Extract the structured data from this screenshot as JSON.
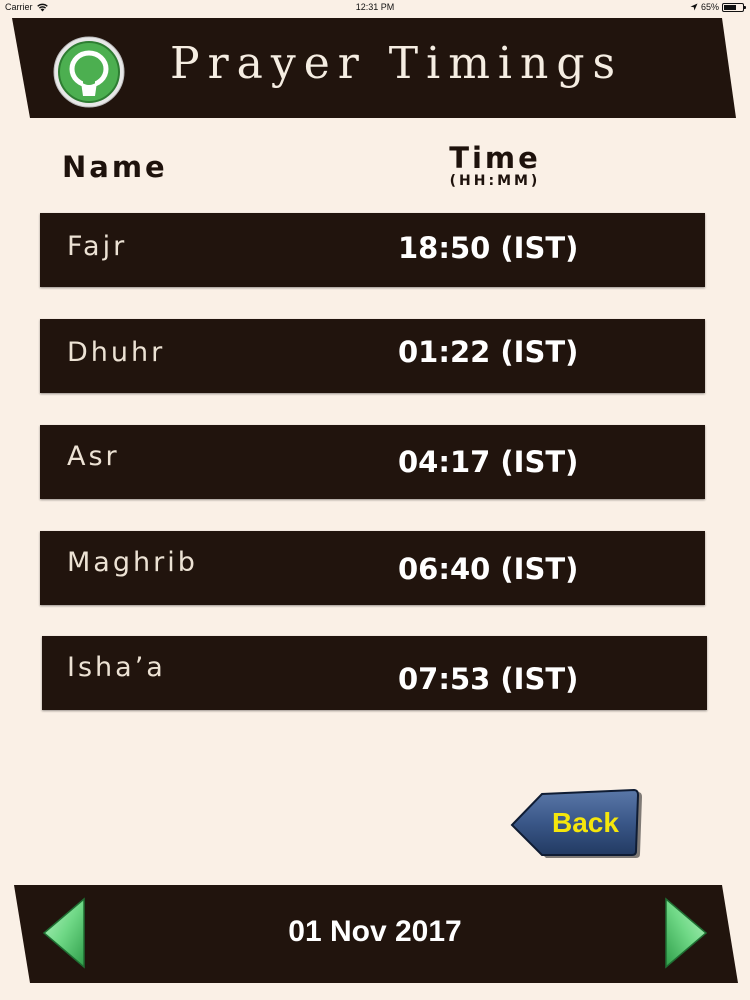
{
  "status_bar": {
    "carrier": "Carrier",
    "time": "12:31 PM",
    "battery": "65%",
    "battery_level": 0.65,
    "icons": [
      "wifi-icon",
      "location-arrow-icon",
      "battery-icon"
    ]
  },
  "header": {
    "title": "Prayer Timings",
    "logo_icon": "app-logo-icon"
  },
  "columns": {
    "name_label": "Name",
    "time_label": "Time",
    "time_unit": "(HH:MM)"
  },
  "prayers": [
    {
      "name": "Fajr",
      "time": "18:50 (IST)"
    },
    {
      "name": "Dhuhr",
      "time": "01:22 (IST)"
    },
    {
      "name": "Asr",
      "time": "04:17 (IST)"
    },
    {
      "name": "Maghrib",
      "time": "06:40 (IST)"
    },
    {
      "name": "Isha’a",
      "time": "07:53 (IST)"
    }
  ],
  "back_button": {
    "label": "Back",
    "icon": "back-arrow-icon"
  },
  "footer": {
    "date": "01 Nov 2017",
    "prev_icon": "previous-arrow-icon",
    "next_icon": "next-arrow-icon"
  },
  "colors": {
    "background": "#faf0e6",
    "banner": "#21140d",
    "row": "#21140d",
    "back_label": "#f5e60c",
    "nav_arrow": "#6fd886",
    "logo_green": "#4caf50"
  }
}
